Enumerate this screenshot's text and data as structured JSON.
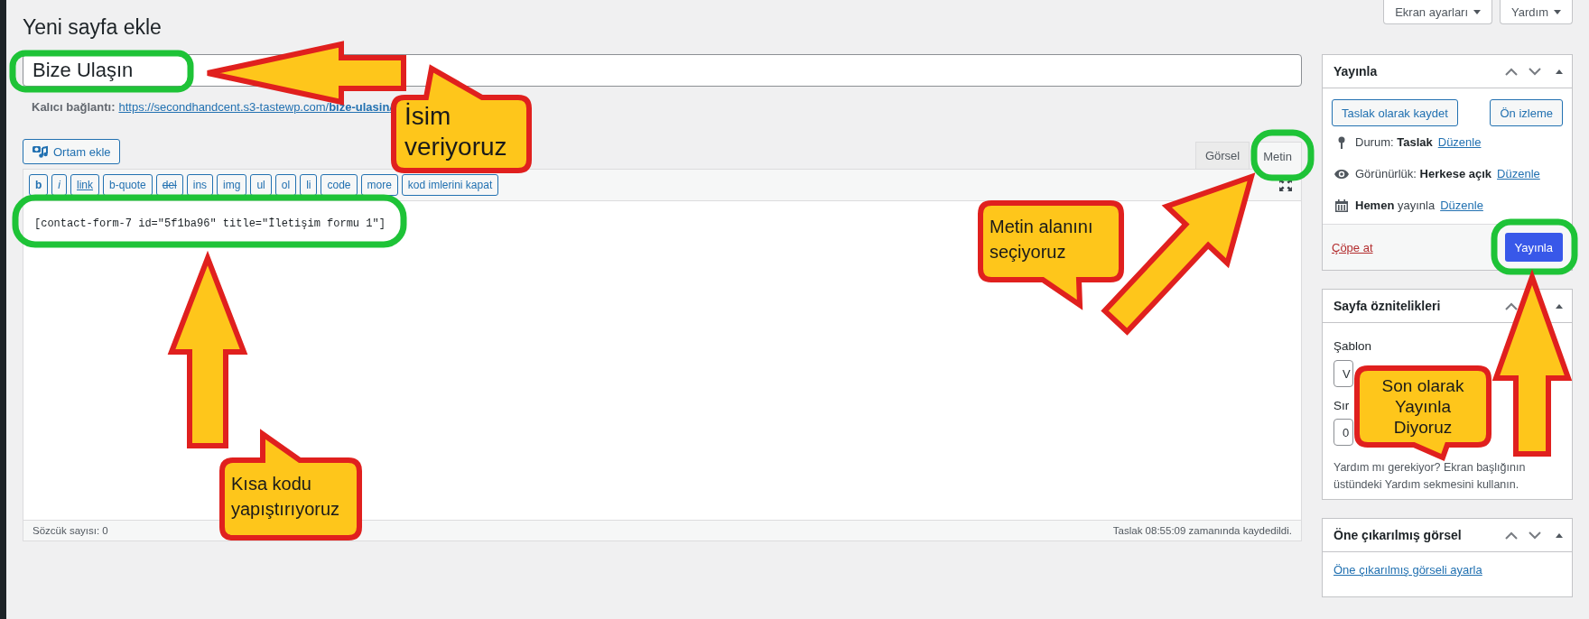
{
  "page_title": "Yeni sayfa ekle",
  "screen_buttons": [
    {
      "label": "Ekran ayarları"
    },
    {
      "label": "Yardım"
    }
  ],
  "title_field": {
    "value": "Bize Ulaşın"
  },
  "permalink": {
    "label": "Kalıcı bağlantı:",
    "link": "https://secondhandcent.s3-tastewp.com/**bize-ulasin**/"
  },
  "media_button": {
    "label": "Ortam ekle"
  },
  "editor_tabs": [
    {
      "label": "Görsel",
      "selected": false
    },
    {
      "label": "Metin",
      "selected": true
    }
  ],
  "quicktags": [
    {
      "label": "b",
      "kind": "bold"
    },
    {
      "label": "i",
      "kind": "italic"
    },
    {
      "label": "link",
      "kind": "link"
    },
    {
      "label": "b-quote",
      "kind": "plain"
    },
    {
      "label": "del",
      "kind": "strike"
    },
    {
      "label": "ins",
      "kind": "plain"
    },
    {
      "label": "img",
      "kind": "plain"
    },
    {
      "label": "ul",
      "kind": "plain"
    },
    {
      "label": "ol",
      "kind": "plain"
    },
    {
      "label": "li",
      "kind": "plain"
    },
    {
      "label": "code",
      "kind": "plain"
    },
    {
      "label": "more",
      "kind": "plain"
    },
    {
      "label": "kod imlerini kapat",
      "kind": "plain"
    }
  ],
  "content": "[contact-form-7 id=\"5f1ba96\" title=\"İletişim formu 1\"]",
  "status_bar": {
    "word_count": "Sözcük sayısı: 0",
    "saved": "Taslak 08:55:09 zamanında kaydedildi."
  },
  "publish_box": {
    "title": "Yayınla",
    "save_draft": "Taslak olarak kaydet",
    "preview": "Ön izleme",
    "rows": [
      {
        "kind": "status",
        "text": "Durum: **Taslak**",
        "link": "Düzenle"
      },
      {
        "kind": "visibility",
        "text": "Görünürlük: **Herkese açık**",
        "link": "Düzenle"
      },
      {
        "kind": "schedule",
        "text": "**Hemen** yayınla",
        "link": "Düzenle"
      }
    ],
    "trash": "Çöpe at",
    "publish": "Yayınla"
  },
  "attributes_box": {
    "title": "Sayfa öznitelikleri",
    "template_label": "Şablon",
    "template_value": "V",
    "order_label": "Sır",
    "order_value": "0",
    "help": "Yardım mı gerekiyor? Ekran başlığının üstündeki Yardım sekmesini kullanın."
  },
  "featured_box": {
    "title": "Öne çıkarılmış görsel",
    "link": "Öne çıkarılmış görseli ayarla"
  },
  "annotations": [
    {
      "text": "İsim veriyoruz"
    },
    {
      "text": "Metin alanını seçiyoruz"
    },
    {
      "text": "Kısa kodu yapıştırıyoruz"
    },
    {
      "text": "Son olarak Yayınla Diyoruz"
    }
  ]
}
